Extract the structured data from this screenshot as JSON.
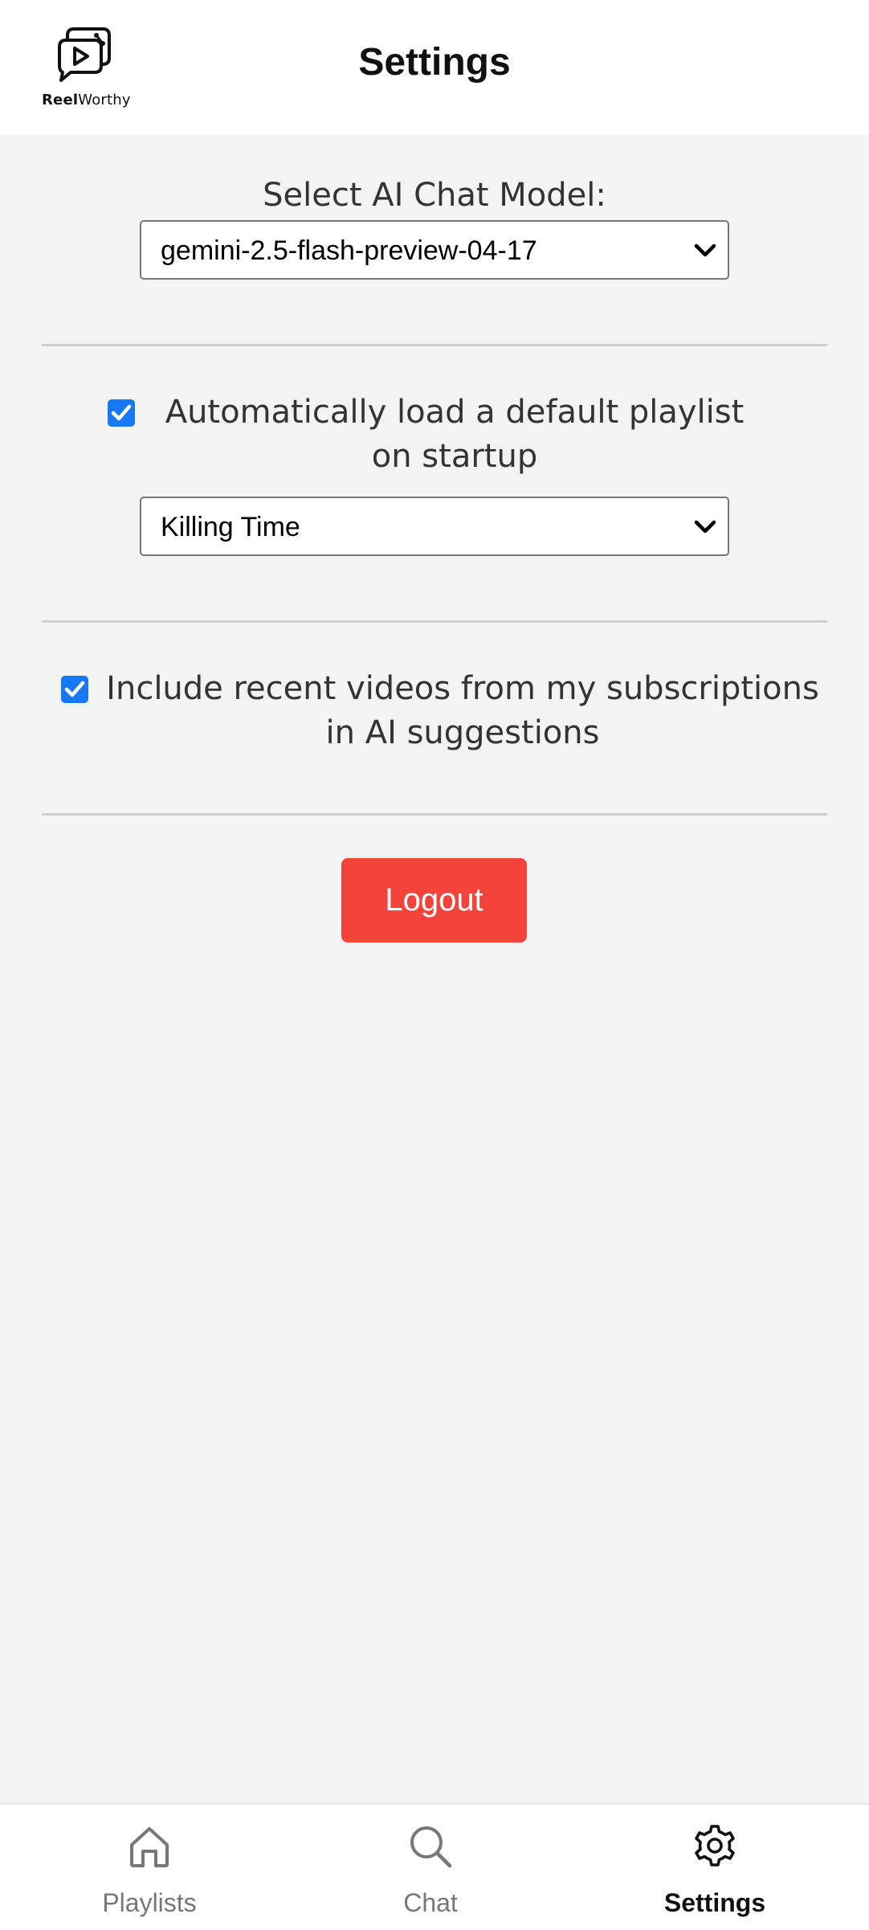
{
  "header": {
    "logo_bold": "Reel",
    "logo_thin": "Worthy",
    "title": "Settings"
  },
  "settings": {
    "model_label": "Select AI Chat Model:",
    "model_value": "gemini-2.5-flash-preview-04-17",
    "autoload_label": "Automatically load a default playlist on startup",
    "autoload_checked": true,
    "playlist_value": "Killing Time",
    "subscriptions_label": "Include recent videos from my subscriptions in AI suggestions",
    "subscriptions_checked": true,
    "logout_label": "Logout"
  },
  "nav": {
    "items": [
      {
        "label": "Playlists",
        "icon": "home-icon"
      },
      {
        "label": "Chat",
        "icon": "search-icon"
      },
      {
        "label": "Settings",
        "icon": "gear-icon",
        "active": true
      }
    ]
  },
  "colors": {
    "accent": "#1877f2",
    "logout": "#f4433a"
  }
}
